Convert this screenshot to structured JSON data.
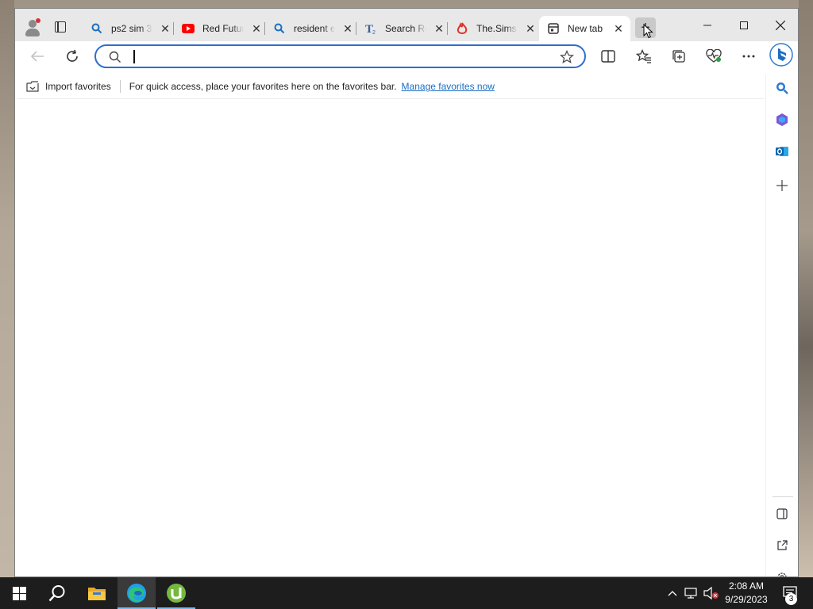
{
  "browser": {
    "tabs": [
      {
        "title": "ps2 sim 3",
        "icon": "search-icon",
        "active": false
      },
      {
        "title": "Red Futur",
        "icon": "youtube-icon",
        "active": false
      },
      {
        "title": "resident e",
        "icon": "search-icon",
        "active": false
      },
      {
        "title": "Search Re",
        "icon": "tunefind-icon",
        "active": false
      },
      {
        "title": "The.Sims",
        "icon": "flame-icon",
        "active": false
      },
      {
        "title": "New tab",
        "icon": "newtab-icon",
        "active": true
      }
    ],
    "address": {
      "value": "",
      "placeholder": ""
    },
    "favorites_bar": {
      "import_label": "Import favorites",
      "message": "For quick access, place your favorites here on the favorites bar.",
      "manage_link": "Manage favorites now"
    }
  },
  "taskbar": {
    "apps": [
      "start-icon",
      "search-icon",
      "file-explorer-icon",
      "edge-icon",
      "utorrent-icon"
    ],
    "time": "2:08 AM",
    "date": "9/29/2023",
    "notification_count": "3"
  },
  "colors": {
    "accent": "#2e6dcc",
    "link": "#1a6ec2",
    "taskbar": "#1d1d1d",
    "tabstrip": "#e8e8e8"
  }
}
